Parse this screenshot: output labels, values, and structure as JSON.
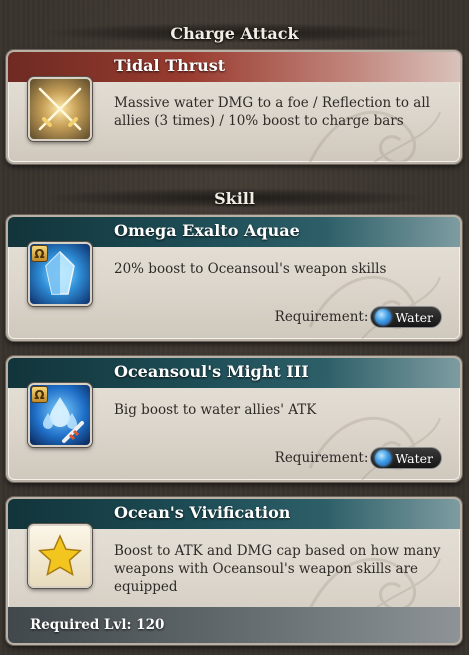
{
  "sections": {
    "charge_attack": "Charge Attack",
    "skill": "Skill"
  },
  "charge_attack": {
    "name": "Tidal Thrust",
    "description": "Massive water DMG to a foe / Reflection to all allies (3 times) / 10% boost to charge bars",
    "icon": "crossed-swords-icon"
  },
  "skills": [
    {
      "name": "Omega Exalto Aquae",
      "description": "20% boost to Oceansoul's weapon skills",
      "requirement_label": "Requirement:",
      "requirement_value": "Water",
      "icon": "water-crystal-icon",
      "badge": "Ω"
    },
    {
      "name": "Oceansoul's Might III",
      "description": "Big boost to water allies' ATK",
      "requirement_label": "Requirement:",
      "requirement_value": "Water",
      "icon": "water-drops-sword-icon",
      "badge": "Ω"
    },
    {
      "name": "Ocean's Vivification",
      "description": "Boost to ATK and DMG cap based on how many weapons with Oceansoul's weapon skills are equipped",
      "icon": "gold-star-icon",
      "required_level": "Required Lvl: 120"
    }
  ],
  "colors": {
    "charge_title": "#9a3c30",
    "skill_title": "#1d4c55",
    "water": "#3f9fe6",
    "star": "#f2c61f"
  }
}
